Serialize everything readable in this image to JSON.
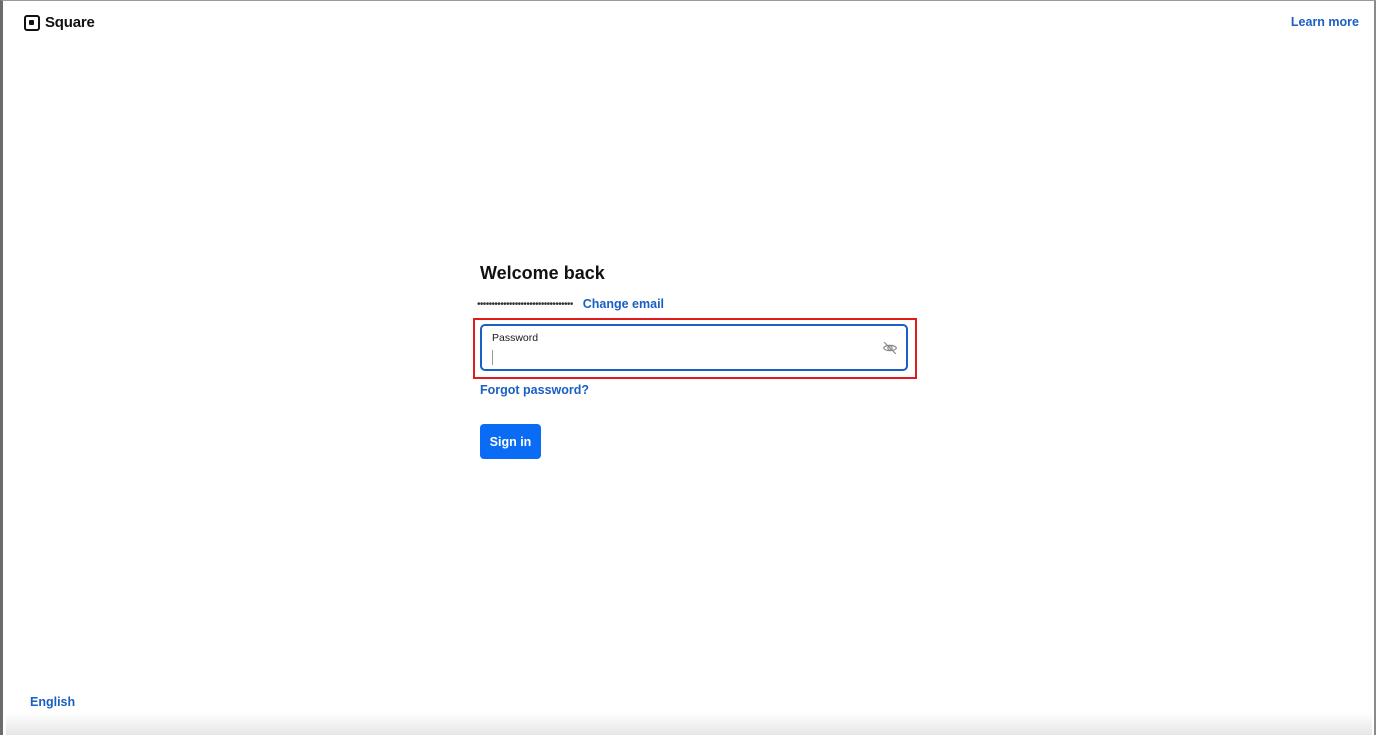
{
  "header": {
    "brand": "Square",
    "learn_more": "Learn more"
  },
  "signin": {
    "title": "Welcome back",
    "email_masked": "•••••••••••••••••••••••••••••••••",
    "change_email": "Change email",
    "password_label": "Password",
    "password_value": "",
    "show_password_icon": "eye-off-icon",
    "forgot_password": "Forgot password?",
    "submit_label": "Sign in"
  },
  "footer": {
    "language": "English"
  },
  "colors": {
    "link": "#1a5fc4",
    "primary_button": "#0a6cf5",
    "focus_border": "#1a5fc4",
    "annotation_highlight": "#e01b1b"
  }
}
